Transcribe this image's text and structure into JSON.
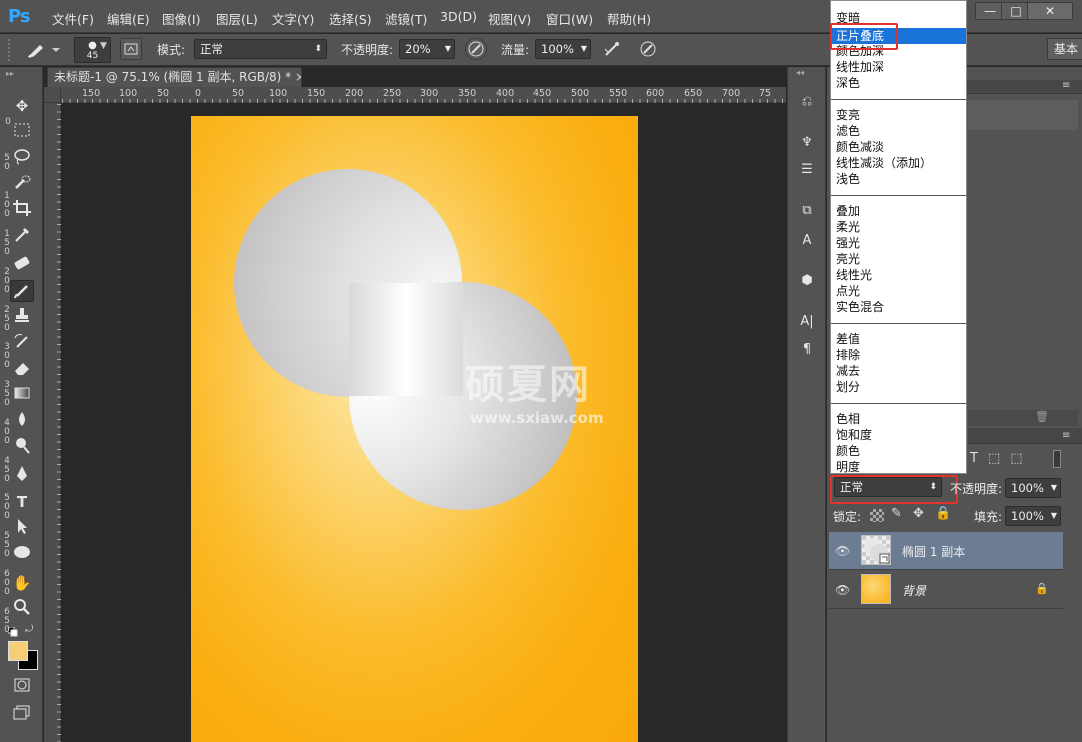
{
  "app": {
    "logo": "Ps"
  },
  "menu": [
    "文件(F)",
    "编辑(E)",
    "图像(I)",
    "图层(L)",
    "文字(Y)",
    "选择(S)",
    "滤镜(T)",
    "3D(D)",
    "视图(V)",
    "窗口(W)",
    "帮助(H)"
  ],
  "window_controls": {
    "minimize": "—",
    "maximize": "□",
    "close": "✕"
  },
  "options_bar": {
    "brush_size": "45",
    "mode_label": "模式:",
    "mode_value": "正常",
    "opacity_label": "不透明度:",
    "opacity_value": "20%",
    "flow_label": "流量:",
    "flow_value": "100%",
    "workspace": "基本"
  },
  "document": {
    "tab_title": "未标题-1 @ 75.1% (椭圆 1 副本, RGB/8) *",
    "tab_close": "×"
  },
  "ruler_h": [
    "150",
    "100",
    "50",
    "0",
    "50",
    "100",
    "150",
    "200",
    "250",
    "300",
    "350",
    "400",
    "450",
    "500",
    "550",
    "600",
    "650",
    "700",
    "75"
  ],
  "ruler_v": [
    "0",
    "50",
    "100",
    "150",
    "200",
    "250",
    "300",
    "350",
    "400",
    "450",
    "500",
    "550",
    "600",
    "650"
  ],
  "watermark": {
    "text": "硕夏网",
    "url": "www.sxiaw.com"
  },
  "colors": {
    "foreground": "#f5cf77",
    "background": "#000000",
    "canvas_orange": "#faab0e",
    "highlight_red": "#e0332b",
    "selection_blue": "#1a73d8"
  },
  "blend_modes": {
    "groups": [
      [
        "变暗",
        "正片叠底",
        "颜色加深",
        "线性加深",
        "深色"
      ],
      [
        "变亮",
        "滤色",
        "颜色减淡",
        "线性减淡（添加）",
        "浅色"
      ],
      [
        "叠加",
        "柔光",
        "强光",
        "亮光",
        "线性光",
        "点光",
        "实色混合"
      ],
      [
        "差值",
        "排除",
        "减去",
        "划分"
      ],
      [
        "色相",
        "饱和度",
        "颜色",
        "明度"
      ]
    ],
    "selected": "正片叠底"
  },
  "layers_panel": {
    "blend_value": "正常",
    "opacity_label": "不透明度:",
    "opacity_value": "100%",
    "lock_label": "锁定:",
    "fill_label": "填充:",
    "fill_value": "100%",
    "layers": [
      {
        "name": "椭圆 1 副本",
        "selected": true
      },
      {
        "name": "背景",
        "selected": false,
        "locked": true
      }
    ]
  }
}
